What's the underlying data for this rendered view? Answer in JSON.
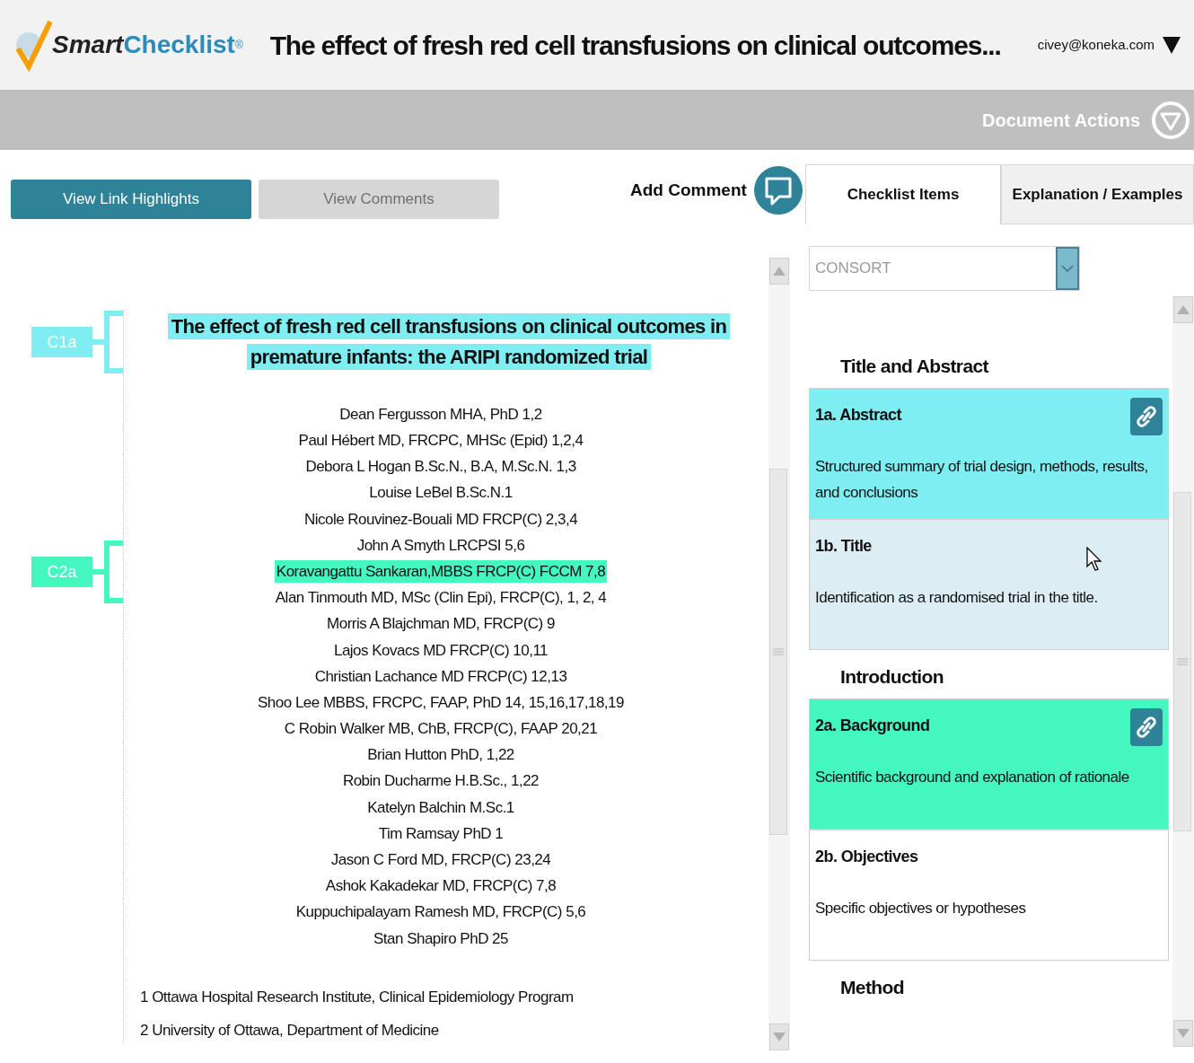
{
  "header": {
    "logo_prefix": "Smart",
    "logo_suffix": "Checklist",
    "logo_mark": "®",
    "title": "The effect of fresh red cell transfusions on clinical outcomes...",
    "user": "civey@koneka.com"
  },
  "action_bar": {
    "label": "Document Actions"
  },
  "toolbar": {
    "buttons": [
      {
        "label": "View Link Highlights",
        "selected": true
      },
      {
        "label": "View Comments",
        "selected": false
      }
    ],
    "add_comment": "Add Comment"
  },
  "markers": [
    {
      "label": "C1a",
      "color": "#7eeef2"
    },
    {
      "label": "C2a",
      "color": "#44f7bf"
    }
  ],
  "document": {
    "title": "The effect of fresh red cell transfusions on clinical outcomes in premature infants: the ARIPI randomized trial",
    "authors": [
      {
        "text": "Dean Fergusson MHA, PhD 1,2",
        "highlighted": false
      },
      {
        "text": "Paul Hébert MD, FRCPC, MHSc (Epid) 1,2,4",
        "highlighted": false
      },
      {
        "text": "Debora L  Hogan B.Sc.N., B.A, M.Sc.N. 1,3",
        "highlighted": false
      },
      {
        "text": "Louise LeBel B.Sc.N.1",
        "highlighted": false
      },
      {
        "text": "Nicole Rouvinez-Bouali MD FRCP(C) 2,3,4",
        "highlighted": false
      },
      {
        "text": "John A Smyth LRCPSI 5,6",
        "highlighted": false
      },
      {
        "text": "Koravangattu Sankaran,MBBS FRCP(C)  FCCM 7,8",
        "highlighted": true
      },
      {
        "text": "Alan Tinmouth MD, MSc (Clin Epi), FRCP(C), 1, 2, 4",
        "highlighted": false
      },
      {
        "text": "Morris A Blajchman MD, FRCP(C) 9",
        "highlighted": false
      },
      {
        "text": "Lajos Kovacs MD FRCP(C) 10,11",
        "highlighted": false
      },
      {
        "text": "Christian Lachance MD FRCP(C) 12,13",
        "highlighted": false
      },
      {
        "text": "Shoo Lee MBBS, FRCPC, FAAP, PhD 14, 15,16,17,18,19",
        "highlighted": false
      },
      {
        "text": "C Robin Walker MB, ChB, FRCP(C), FAAP 20,21",
        "highlighted": false
      },
      {
        "text": "Brian Hutton PhD, 1,22",
        "highlighted": false
      },
      {
        "text": "Robin Ducharme H.B.Sc., 1,22",
        "highlighted": false
      },
      {
        "text": "Katelyn Balchin M.Sc.1",
        "highlighted": false
      },
      {
        "text": "Tim Ramsay PhD 1",
        "highlighted": false
      },
      {
        "text": "Jason C Ford MD, FRCP(C) 23,24",
        "highlighted": false
      },
      {
        "text": "Ashok Kakadekar MD, FRCP(C) 7,8",
        "highlighted": false
      },
      {
        "text": "Kuppuchipalayam Ramesh MD, FRCP(C) 5,6",
        "highlighted": false
      },
      {
        "text": "Stan Shapiro PhD 25",
        "highlighted": false
      }
    ],
    "affiliations": [
      "1 Ottawa Hospital Research Institute, Clinical Epidemiology Program",
      "2 University of Ottawa, Department of Medicine"
    ]
  },
  "tabs": [
    {
      "label": "Checklist Items",
      "selected": true
    },
    {
      "label": "Explanation / Examples",
      "selected": false
    }
  ],
  "checklist_select": {
    "value": "CONSORT"
  },
  "sections": [
    {
      "title": "Title and Abstract",
      "items": [
        {
          "title": "1a. Abstract",
          "description": "Structured summary of trial design, methods, results, and conclusions",
          "color": "#7eeef2",
          "linked": true,
          "hovered": false
        },
        {
          "title": "1b. Title",
          "description": "Identification as a randomised trial in the title.",
          "color": "#dcedf3",
          "linked": false,
          "hovered": true
        }
      ]
    },
    {
      "title": "Introduction",
      "items": [
        {
          "title": "2a. Background",
          "description": "Scientific background and explanation of rationale",
          "color": "#44f7bf",
          "linked": true,
          "hovered": false
        },
        {
          "title": "2b. Objectives",
          "description": "Specific objectives or hypotheses",
          "color": "#ffffff",
          "linked": false,
          "hovered": false
        }
      ]
    },
    {
      "title": "Method"
    }
  ]
}
